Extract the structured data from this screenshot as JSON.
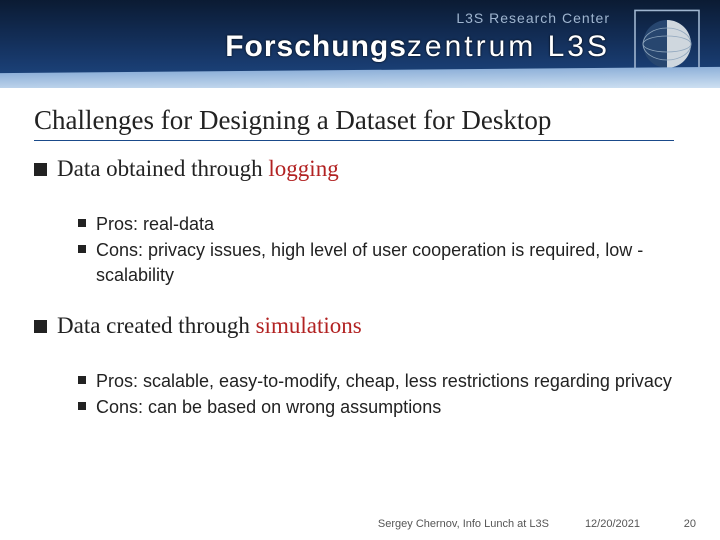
{
  "header": {
    "brand_sub": "L3S Research Center",
    "brand_main_prefix": "Forschungs",
    "brand_main_suffix": "zentrum L3S"
  },
  "title": "Challenges for Designing a Dataset for Desktop",
  "sections": [
    {
      "lead": "Data obtained through ",
      "highlight": "logging",
      "items": [
        "Pros: real-data",
        "Cons: privacy issues, high level of user cooperation is required, low -scalability"
      ]
    },
    {
      "lead": "Data created through ",
      "highlight": "simulations",
      "items": [
        "Pros: scalable, easy-to-modify, cheap, less restrictions regarding privacy",
        "Cons: can be based on wrong assumptions"
      ]
    }
  ],
  "footer": {
    "author": "Sergey Chernov, Info Lunch at L3S",
    "date": "12/20/2021",
    "page": "20"
  }
}
